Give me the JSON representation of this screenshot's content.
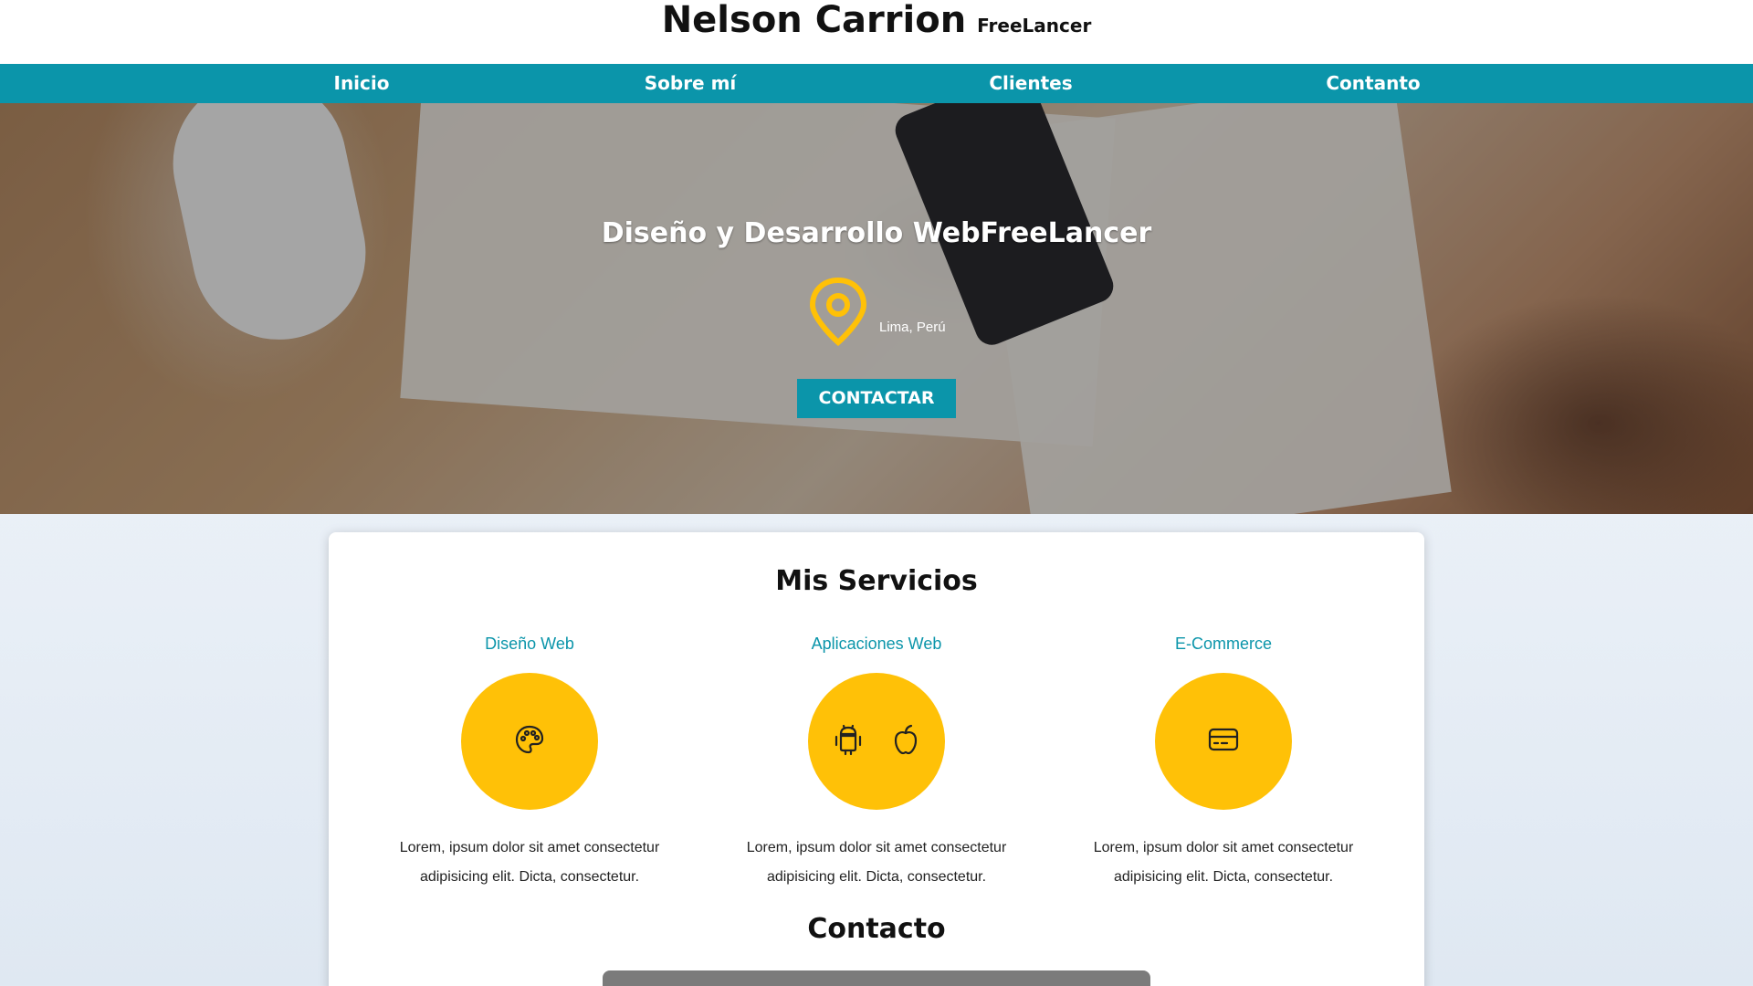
{
  "header": {
    "brand_name": "Nelson Carrion",
    "brand_tag": "FreeLancer"
  },
  "nav": {
    "items": [
      "Inicio",
      "Sobre mí",
      "Clientes",
      "Contanto"
    ]
  },
  "hero": {
    "title": "Diseño y Desarrollo WebFreeLancer",
    "location_icon": "map-pin-icon",
    "location": "Lima, Perú",
    "cta_label": "CONTACTAR"
  },
  "services": {
    "title": "Mis Servicios",
    "items": [
      {
        "title": "Diseño Web",
        "icons": [
          "palette-icon"
        ],
        "desc_line1": "Lorem, ipsum dolor sit amet consectetur",
        "desc_line2": "adipisicing elit. Dicta, consectetur."
      },
      {
        "title": "Aplicaciones Web",
        "icons": [
          "android-icon",
          "apple-icon"
        ],
        "desc_line1": "Lorem, ipsum dolor sit amet consectetur",
        "desc_line2": "adipisicing elit. Dicta, consectetur."
      },
      {
        "title": "E-Commerce",
        "icons": [
          "credit-card-icon"
        ],
        "desc_line1": "Lorem, ipsum dolor sit amet consectetur",
        "desc_line2": "adipisicing elit. Dicta, consectetur."
      }
    ]
  },
  "contact": {
    "title": "Contacto"
  },
  "colors": {
    "accent": "#0b95aa",
    "yellow": "#ffc107"
  }
}
